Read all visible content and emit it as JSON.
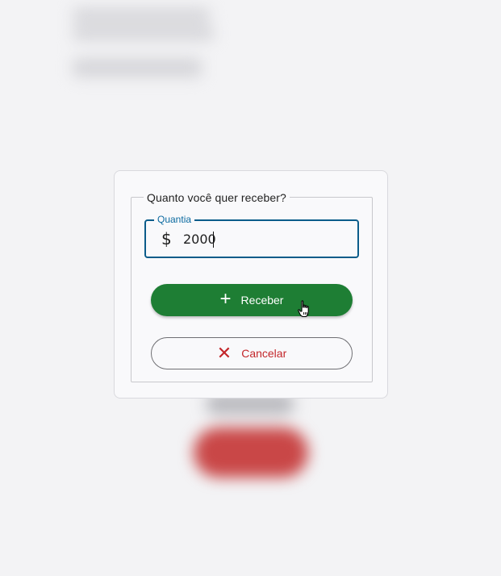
{
  "dialog": {
    "legend": "Quanto você quer receber?",
    "amount": {
      "label": "Quantia",
      "currency_icon": "$",
      "value": "2000"
    },
    "receive_button": {
      "label": "Receber",
      "icon": "plus-icon"
    },
    "cancel_button": {
      "label": "Cancelar",
      "icon": "close-icon"
    }
  },
  "colors": {
    "receive_button_bg": "#1e7e34",
    "cancel_text": "#c3262a",
    "field_border": "#0b5c8a"
  }
}
